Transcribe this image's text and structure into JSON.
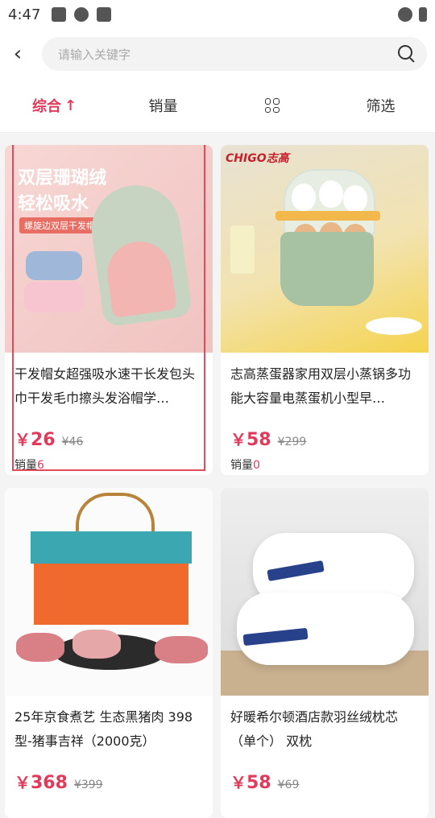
{
  "status": {
    "time": "4:47"
  },
  "search": {
    "placeholder": "请输入关键字"
  },
  "tabs": [
    {
      "label": "综合",
      "arrow": "↑",
      "active": true
    },
    {
      "label": "销量"
    },
    {
      "label": "",
      "icon": "grid-view-icon"
    },
    {
      "label": "筛选"
    }
  ],
  "products": [
    {
      "title": "干发帽女超强吸水速干长发包头巾干发毛巾擦头发浴帽学…",
      "price_symbol": "￥",
      "price": "26",
      "original_price": "¥46",
      "sales_label": "销量",
      "sales": "6",
      "img_text": "双层珊瑚绒轻松吸水",
      "img_tag": "螺旋边双层干发帽"
    },
    {
      "title": "志高蒸蛋器家用双层小蒸锅多功能大容量电蒸蛋机小型早…",
      "price_symbol": "￥",
      "price": "58",
      "original_price": "¥299",
      "sales_label": "销量",
      "sales": "0",
      "img_brand": "CHIGO志高"
    },
    {
      "title": "25年京食煮艺 生态黑猪肉 398型-猪事吉祥（2000克）",
      "price_symbol": "￥",
      "price": "368",
      "original_price": "¥399"
    },
    {
      "title": "好暖希尔顿酒店款羽丝绒枕芯（单个） 双枕",
      "price_symbol": "￥",
      "price": "58",
      "original_price": "¥69"
    }
  ],
  "colors": {
    "accent": "#e23a5b"
  }
}
